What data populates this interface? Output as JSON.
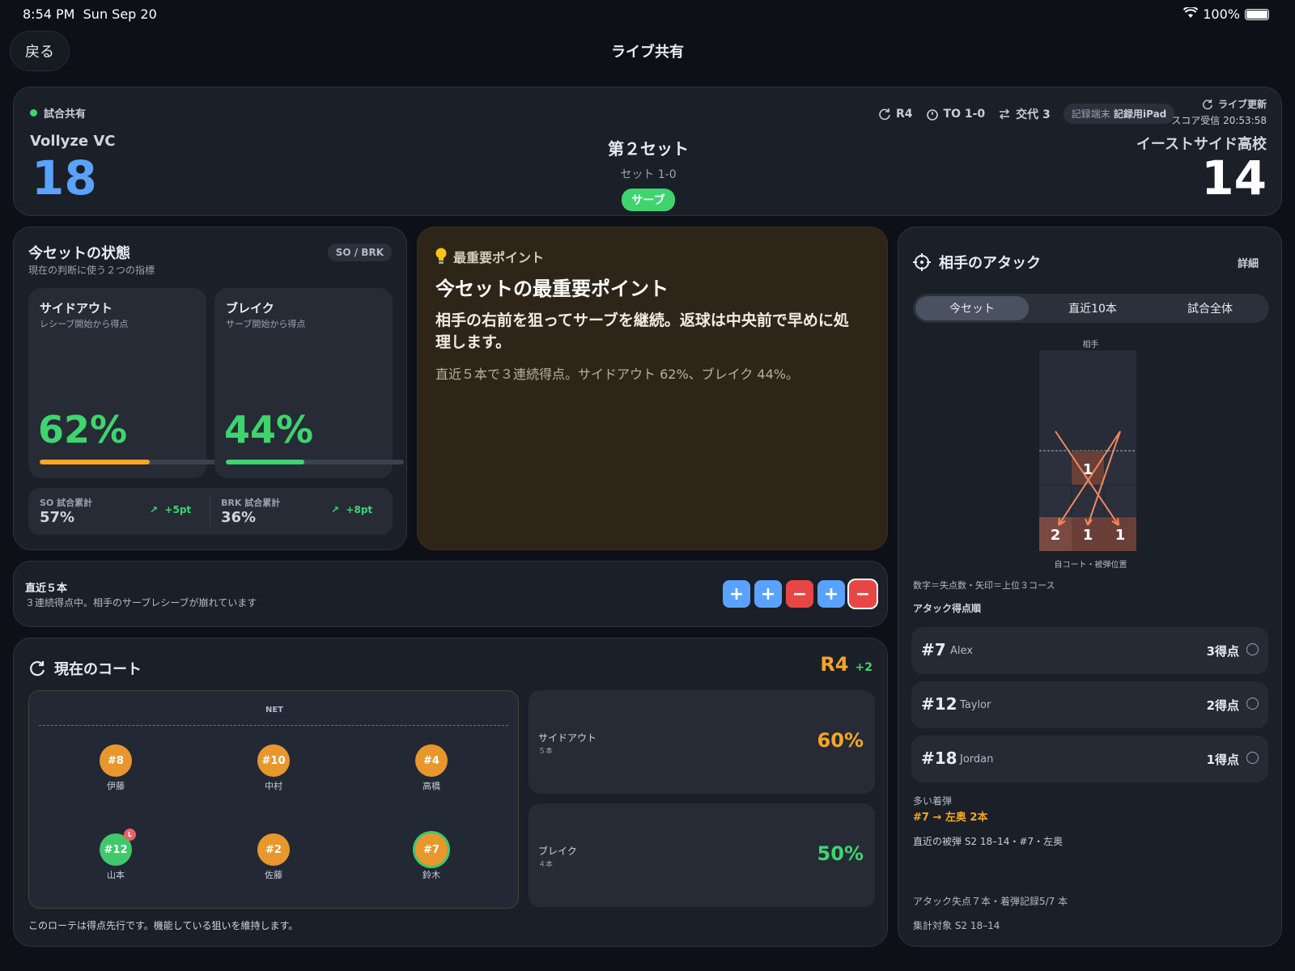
{
  "status_bar": {
    "time": "8:54 PM",
    "date": "Sun Sep 20",
    "battery": "100%"
  },
  "nav": {
    "back_label": "戻る",
    "title": "ライブ共有"
  },
  "scoreboard": {
    "live_label": "試合共有",
    "rotation": "R4",
    "timeout": "TO 1-0",
    "subs": "交代 3",
    "device_label": "記録端末",
    "device_name": "記録用iPad",
    "live_update": "ライブ更新",
    "score_received": "スコア受信 20:53:58",
    "home_name": "Vollyze VC",
    "home_score": "18",
    "away_name": "イーストサイド高校",
    "away_score": "14",
    "set_title": "第２セット",
    "set_score": "セット 1-0",
    "serve_badge": "サーブ"
  },
  "set_state": {
    "title": "今セットの状態",
    "subtitle": "現在の判断に使う２つの指標",
    "tag": "SO / BRK",
    "sideout": {
      "title": "サイドアウト",
      "sub": "レシーブ開始から得点",
      "value": "62%",
      "pct": 0.62
    },
    "break": {
      "title": "ブレイク",
      "sub": "サーブ開始から得点",
      "value": "44%",
      "pct": 0.44
    },
    "so_total_label": "SO 試合累計",
    "so_total": "57%",
    "so_delta": "+5pt",
    "brk_total_label": "BRK 試合累計",
    "brk_total": "36%",
    "brk_delta": "+8pt"
  },
  "key_point": {
    "label": "最重要ポイント",
    "title": "今セットの最重要ポイント",
    "body": "相手の右前を狙ってサーブを継続。返球は中央前で早めに処理します。",
    "note": "直近５本で３連続得点。サイドアウト 62%、ブレイク 44%。"
  },
  "recent": {
    "title": "直近５本",
    "desc": "３連続得点中。相手のサーブレシーブが崩れています",
    "results": [
      "+",
      "+",
      "−",
      "+",
      "−"
    ]
  },
  "court": {
    "title": "現在のコート",
    "rotation": "R4",
    "rotation_delta": "+2",
    "net_label": "NET",
    "players": [
      {
        "num": "#8",
        "name": "伊藤"
      },
      {
        "num": "#10",
        "name": "中村"
      },
      {
        "num": "#4",
        "name": "高橋"
      },
      {
        "num": "#12",
        "name": "山本",
        "libero": "L"
      },
      {
        "num": "#2",
        "name": "佐藤"
      },
      {
        "num": "#7",
        "name": "鈴木"
      }
    ],
    "sideout": {
      "label": "サイドアウト",
      "count": "５本",
      "value": "60%"
    },
    "break": {
      "label": "ブレイク",
      "count": "４本",
      "value": "50%"
    },
    "footer": "このローテは得点先行です。機能している狙いを維持します。"
  },
  "opp_attack": {
    "title": "相手のアタック",
    "detail": "詳細",
    "tabs": [
      "今セット",
      "直近10本",
      "試合全体"
    ],
    "opp_label": "相手",
    "court_label": "自コート・被弾位置",
    "cells": {
      "mid": "1",
      "back_left": "2",
      "back_mid": "1",
      "back_right": "1"
    },
    "legend": "数字＝失点数・矢印＝上位３コース",
    "ranking_title": "アタック得点順",
    "ranking": [
      {
        "num": "#7",
        "name": "Alex",
        "points": "3得点"
      },
      {
        "num": "#12",
        "name": "Taylor",
        "points": "2得点"
      },
      {
        "num": "#18",
        "name": "Jordan",
        "points": "1得点"
      }
    ],
    "frequent_label": "多い着弾",
    "frequent_value": "#7 → 左奥 2本",
    "recent_hit": "直近の被弾 S2 18–14・#7・左奥",
    "summary": "アタック失点７本・着弾記録5/7 本",
    "scope": "集計対象 S2 18–14"
  },
  "colors": {
    "green": "#3fd46e",
    "orange": "#f5a623",
    "blue": "#5aa2ff",
    "red": "#e84646"
  }
}
